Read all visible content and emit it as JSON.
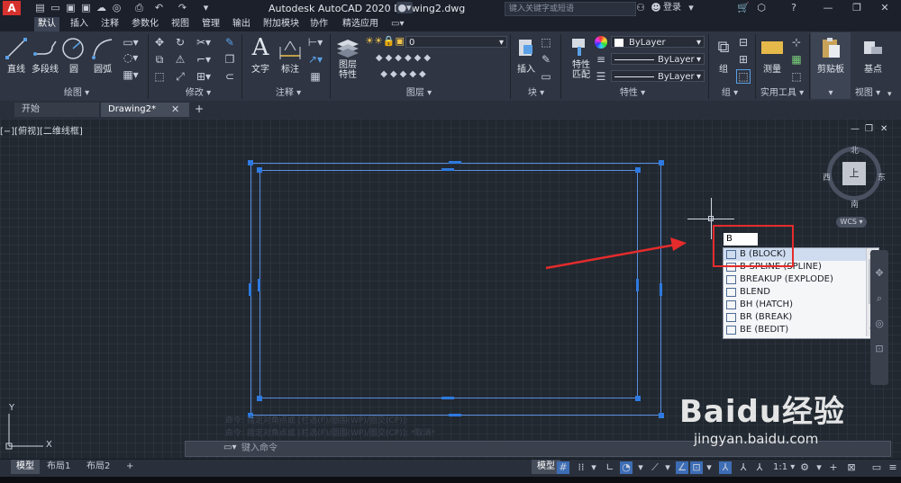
{
  "titlebar": {
    "logo": "A",
    "title": "Autodesk AutoCAD 2020    Drawing2.dwg",
    "search_placeholder": "键入关键字或短语",
    "login": "登录"
  },
  "menu_tabs": [
    "默认",
    "插入",
    "注释",
    "参数化",
    "视图",
    "管理",
    "输出",
    "附加模块",
    "协作",
    "精选应用"
  ],
  "ribbon": {
    "draw": {
      "line": "直线",
      "polyline": "多段线",
      "circle": "圆",
      "arc": "圆弧",
      "panel": "绘图"
    },
    "modify": {
      "panel": "修改"
    },
    "annotation": {
      "text": "文字",
      "dimension": "标注",
      "panel": "注释"
    },
    "layers": {
      "layer_properties": "图层\n特性",
      "layer_combo": "0",
      "panel": "图层"
    },
    "block": {
      "insert": "插入",
      "panel": "块"
    },
    "properties": {
      "match": "特性\n匹配",
      "color": "ByLayer",
      "linetype": "ByLayer",
      "lineweight": "ByLayer",
      "panel": "特性"
    },
    "groups": {
      "group": "组",
      "panel": "组"
    },
    "utilities": {
      "measure": "测量",
      "panel": "实用工具"
    },
    "clipboard": {
      "paste": "剪贴板"
    },
    "view": {
      "base": "基点",
      "panel": "视图"
    }
  },
  "doc_tabs": [
    "开始",
    "Drawing2*"
  ],
  "viewport_label": "[−][俯视][二维线框]",
  "navcube": {
    "north": "北",
    "south": "南",
    "east": "东",
    "west": "西",
    "face": "上",
    "wcs": "WCS"
  },
  "autocomplete": {
    "typed": "B",
    "items": [
      "B (BLOCK)",
      "B-SPLINE (SPLINE)",
      "BREAKUP (EXPLODE)",
      "BLEND",
      "BH (HATCH)",
      "BR (BREAK)",
      "BE (BEDIT)"
    ],
    "selected_index": 0
  },
  "command_line": {
    "placeholder": "键入命令",
    "history1": "命令: 指定对角点或 [栏选(F)/圈围(WP)/圈交(CP)]:",
    "history2": "命令: 指定对角点或 [栏选(F)/圈围(WP)/圈交(CP)]: *取消*"
  },
  "layout_tabs": [
    "模型",
    "布局1",
    "布局2"
  ],
  "status": {
    "model": "模型",
    "scale": "1:1"
  },
  "watermark": {
    "brand": "Baidu经验",
    "url": "jingyan.baidu.com"
  },
  "colors": {
    "accent": "#2e7ae0",
    "highlight": "#e52b2b",
    "ribbon": "#2f3542",
    "canvas": "#212830"
  }
}
